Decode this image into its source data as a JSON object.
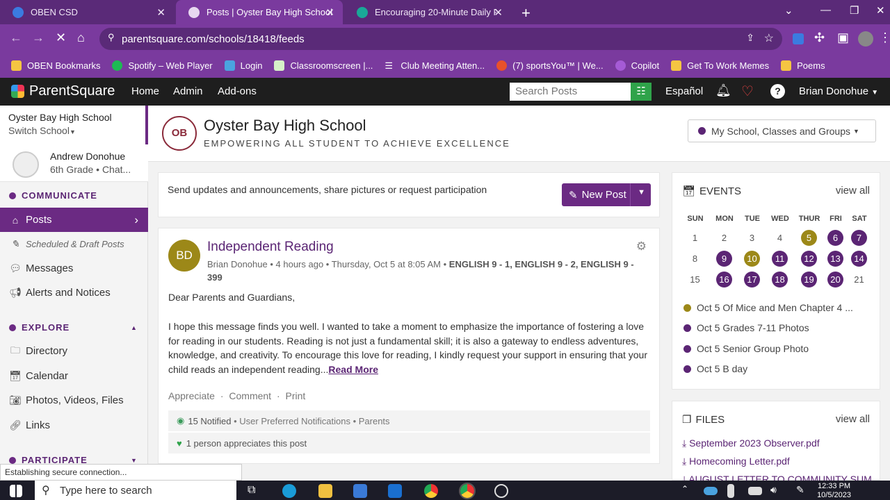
{
  "browser": {
    "tabs": [
      {
        "title": "OBEN CSD",
        "active": false
      },
      {
        "title": "Posts | Oyster Bay High School",
        "active": true
      },
      {
        "title": "Encouraging 20-Minute Daily Re",
        "active": false
      }
    ],
    "url": "parentsquare.com/schools/18418/feeds",
    "bookmarks": [
      "OBEN Bookmarks",
      "Spotify – Web Player",
      "Login",
      "Classroomscreen |...",
      "Club Meeting Atten...",
      "(7) sportsYou™ | We...",
      "Copilot",
      "Get To Work Memes",
      "Poems"
    ]
  },
  "topnav": {
    "brand": "ParentSquare",
    "links": [
      "Home",
      "Admin",
      "Add-ons"
    ],
    "search_placeholder": "Search Posts",
    "language": "Español",
    "user": "Brian Donohue"
  },
  "sidebar": {
    "school_name": "Oyster Bay High School",
    "switch_label": "Switch School",
    "child_name": "Andrew Donohue",
    "child_detail": "6th Grade • Chat...",
    "communicate_heading": "COMMUNICATE",
    "communicate_items": [
      {
        "label": "Posts",
        "icon": "home-icon",
        "active": true
      },
      {
        "label": "Scheduled & Draft Posts",
        "icon": "pencil-icon",
        "active": false
      },
      {
        "label": "Messages",
        "icon": "chat-icon",
        "active": false
      },
      {
        "label": "Alerts and Notices",
        "icon": "megaphone-icon",
        "active": false
      }
    ],
    "explore_heading": "EXPLORE",
    "explore_items": [
      {
        "label": "Directory",
        "icon": "folder-icon"
      },
      {
        "label": "Calendar",
        "icon": "calendar-icon"
      },
      {
        "label": "Photos, Videos, Files",
        "icon": "camera-icon"
      },
      {
        "label": "Links",
        "icon": "link-icon"
      }
    ],
    "participate_heading": "PARTICIPATE"
  },
  "header": {
    "school_title": "Oyster Bay High School",
    "motto": "EMPOWERING ALL STUDENT TO ACHIEVE EXCELLENCE",
    "seal_text": "OB",
    "group_select": "My School, Classes and Groups"
  },
  "composer": {
    "prompt": "Send updates and announcements, share pictures or request participation",
    "new_post_label": "New Post"
  },
  "post": {
    "avatar_initials": "BD",
    "title": "Independent Reading",
    "author": "Brian Donohue",
    "time_ago": "4 hours ago",
    "date": "Thursday, Oct 5 at 8:05 AM",
    "groups": "ENGLISH 9 - 1, ENGLISH 9 - 2, ENGLISH 9 - 399",
    "greeting": "Dear Parents and Guardians,",
    "body": "I hope this message finds you well. I wanted to take a moment to emphasize the importance of fostering a love for reading in our students. Reading is not just a fundamental skill; it is also a gateway to endless adventures, knowledge, and creativity. To encourage this love for reading, I kindly request your support in ensuring that your child reads an independent reading...",
    "read_more": "Read More",
    "actions": [
      "Appreciate",
      "Comment",
      "Print"
    ],
    "notified": "15 Notified",
    "notified_detail": "• User Preferred Notifications • Parents",
    "appreciation": "1 person appreciates this post"
  },
  "events": {
    "heading": "EVENTS",
    "view_all": "view all",
    "weekdays": [
      "SUN",
      "MON",
      "TUE",
      "WED",
      "THUR",
      "FRI",
      "SAT"
    ],
    "weeks": [
      [
        {
          "d": "1",
          "s": ""
        },
        {
          "d": "2",
          "s": ""
        },
        {
          "d": "3",
          "s": ""
        },
        {
          "d": "4",
          "s": ""
        },
        {
          "d": "5",
          "s": "g"
        },
        {
          "d": "6",
          "s": "p"
        },
        {
          "d": "7",
          "s": "p"
        }
      ],
      [
        {
          "d": "8",
          "s": ""
        },
        {
          "d": "9",
          "s": "p"
        },
        {
          "d": "10",
          "s": "g"
        },
        {
          "d": "11",
          "s": "p"
        },
        {
          "d": "12",
          "s": "p"
        },
        {
          "d": "13",
          "s": "p"
        },
        {
          "d": "14",
          "s": "p"
        }
      ],
      [
        {
          "d": "15",
          "s": ""
        },
        {
          "d": "16",
          "s": "p"
        },
        {
          "d": "17",
          "s": "p"
        },
        {
          "d": "18",
          "s": "p"
        },
        {
          "d": "19",
          "s": "p"
        },
        {
          "d": "20",
          "s": "p"
        },
        {
          "d": "21",
          "s": ""
        }
      ]
    ],
    "items": [
      {
        "label": "Oct 5 Of Mice and Men Chapter 4 ...",
        "color": "#9c8818"
      },
      {
        "label": "Oct 5 Grades 7-11 Photos",
        "color": "#5b2574"
      },
      {
        "label": "Oct 5 Senior Group Photo",
        "color": "#5b2574"
      },
      {
        "label": "Oct 5 B day",
        "color": "#5b2574"
      }
    ]
  },
  "files": {
    "heading": "FILES",
    "view_all": "view all",
    "items": [
      "September 2023 Observer.pdf",
      "Homecoming Letter.pdf",
      "AUGUST LETTER TO COMMUNITY SUM..."
    ]
  },
  "status_text": "Establishing secure connection...",
  "taskbar": {
    "search_placeholder": "Type here to search",
    "time": "12:33 PM",
    "date": "10/5/2023"
  },
  "colors": {
    "brand_purple": "#6b2a83",
    "gold": "#9c8818",
    "chrome_purple": "#7a3a9e"
  }
}
